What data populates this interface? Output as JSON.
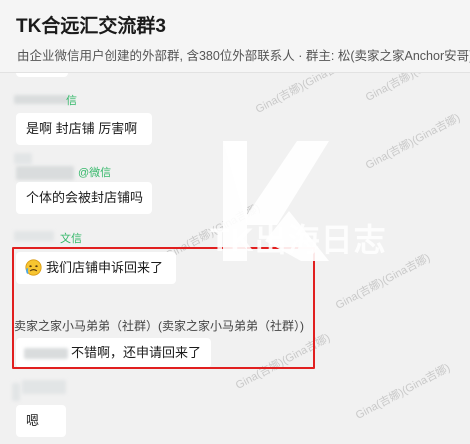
{
  "header": {
    "title": "TK合远汇交流群3",
    "subtitle": "由企业微信用户创建的外部群, 含380位外部联系人 · 群主: 松(卖家之家Anchor安哥)"
  },
  "messages": [
    {
      "text": "是啊 封店铺 厉害啊"
    },
    {
      "tag": "@微信",
      "text": "个体的会被封店铺吗"
    },
    {
      "tag": "文信",
      "text": "我们店铺申诉回来了"
    },
    {
      "sender": "卖家之家小马弟弟（社群）(卖家之家小马弟弟（社群）)",
      "text": "不错啊，还申请回来了"
    },
    {
      "text": "嗯"
    }
  ],
  "watermark": {
    "brand": "TK出海日志",
    "repeat_text": "Gina(吉娜)(Gina吉娜)"
  },
  "colors": {
    "highlight": "#e11f1f",
    "wechat_green": "#35b86a",
    "bubble": "#ffffff",
    "background": "#f1f1f1"
  }
}
